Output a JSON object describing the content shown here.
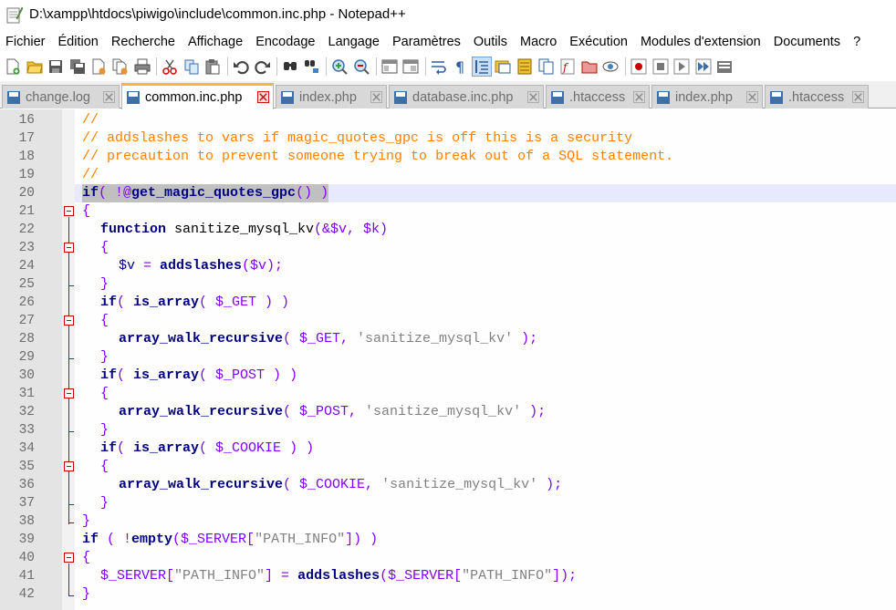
{
  "window": {
    "title": "D:\\xampp\\htdocs\\piwigo\\include\\common.inc.php - Notepad++"
  },
  "menu": [
    "Fichier",
    "Édition",
    "Recherche",
    "Affichage",
    "Encodage",
    "Langage",
    "Paramètres",
    "Outils",
    "Macro",
    "Exécution",
    "Modules d'extension",
    "Documents",
    "?"
  ],
  "toolbar": {
    "icons": [
      "new-file-icon",
      "open-file-icon",
      "save-icon",
      "save-all-icon",
      "close-icon",
      "close-all-icon",
      "print-icon",
      "cut-icon",
      "copy-icon",
      "paste-icon",
      "undo-icon",
      "redo-icon",
      "find-icon",
      "replace-icon",
      "zoom-in-icon",
      "zoom-out-icon",
      "sync-vertical-icon",
      "sync-horizontal-icon",
      "word-wrap-icon",
      "show-all-chars-icon",
      "indent-guide-icon",
      "user-lang-icon",
      "doc-map-icon",
      "doc-list-icon",
      "function-list-icon",
      "folder-workspace-icon",
      "monitoring-icon",
      "record-macro-icon",
      "stop-macro-icon",
      "play-macro-icon",
      "run-macro-multiple-icon",
      "save-macro-icon"
    ]
  },
  "tabs": [
    {
      "label": "change.log",
      "active": false
    },
    {
      "label": "common.inc.php",
      "active": true
    },
    {
      "label": "index.php",
      "active": false
    },
    {
      "label": "database.inc.php",
      "active": false
    },
    {
      "label": ".htaccess",
      "active": false
    },
    {
      "label": "index.php",
      "active": false
    },
    {
      "label": ".htaccess",
      "active": false
    }
  ],
  "editor": {
    "current_line": 20,
    "lines": [
      {
        "n": "16"
      },
      {
        "n": "17"
      },
      {
        "n": "18"
      },
      {
        "n": "19"
      },
      {
        "n": "20"
      },
      {
        "n": "21"
      },
      {
        "n": "22"
      },
      {
        "n": "23"
      },
      {
        "n": "24"
      },
      {
        "n": "25"
      },
      {
        "n": "26"
      },
      {
        "n": "27"
      },
      {
        "n": "28"
      },
      {
        "n": "29"
      },
      {
        "n": "30"
      },
      {
        "n": "31"
      },
      {
        "n": "32"
      },
      {
        "n": "33"
      },
      {
        "n": "34"
      },
      {
        "n": "35"
      },
      {
        "n": "36"
      },
      {
        "n": "37"
      },
      {
        "n": "38"
      },
      {
        "n": "39"
      },
      {
        "n": "40"
      },
      {
        "n": "41"
      },
      {
        "n": "42"
      }
    ],
    "code": {
      "l16": "//",
      "l17": "// addslashes to vars if magic_quotes_gpc is off this is a security",
      "l18": "// precaution to prevent someone trying to break out of a SQL statement.",
      "l19": "//",
      "l20_kw": "if",
      "l20_a": "( !@",
      "l20_fn": "get_magic_quotes_gpc",
      "l20_b": "() )",
      "l21": "{",
      "l22_kw": "function",
      "l22_name": " sanitize_mysql_kv",
      "l22_args": "(&$v, $k)",
      "l23": "{",
      "l24_v": "$v",
      "l24_eq": " = ",
      "l24_fn": "addslashes",
      "l24_args": "($v);",
      "l25": "}",
      "l26_kw": "if",
      "l26_a": "( ",
      "l26_fn": "is_array",
      "l26_b": "( $_GET ) )",
      "l27": "{",
      "l28_fn": "array_walk_recursive",
      "l28_a": "( $_GET, ",
      "l28_s": "'sanitize_mysql_kv'",
      "l28_b": " );",
      "l29": "}",
      "l30_kw": "if",
      "l30_a": "( ",
      "l30_fn": "is_array",
      "l30_b": "( $_POST ) )",
      "l31": "{",
      "l32_fn": "array_walk_recursive",
      "l32_a": "( $_POST, ",
      "l32_s": "'sanitize_mysql_kv'",
      "l32_b": " );",
      "l33": "}",
      "l34_kw": "if",
      "l34_a": "( ",
      "l34_fn": "is_array",
      "l34_b": "( $_COOKIE ) )",
      "l35": "{",
      "l36_fn": "array_walk_recursive",
      "l36_a": "( $_COOKIE, ",
      "l36_s": "'sanitize_mysql_kv'",
      "l36_b": " );",
      "l37": "}",
      "l38": "}",
      "l39_kw": "if",
      "l39_a": " ( !",
      "l39_fn": "empty",
      "l39_b": "($_SERVER[",
      "l39_s": "\"PATH_INFO\"",
      "l39_c": "]) )",
      "l40": "{",
      "l41_a": "$_SERVER[",
      "l41_s1": "\"PATH_INFO\"",
      "l41_b": "] = ",
      "l41_fn": "addslashes",
      "l41_c": "($_SERVER[",
      "l41_s2": "\"PATH_INFO\"",
      "l41_d": "]);",
      "l42": "}"
    }
  }
}
